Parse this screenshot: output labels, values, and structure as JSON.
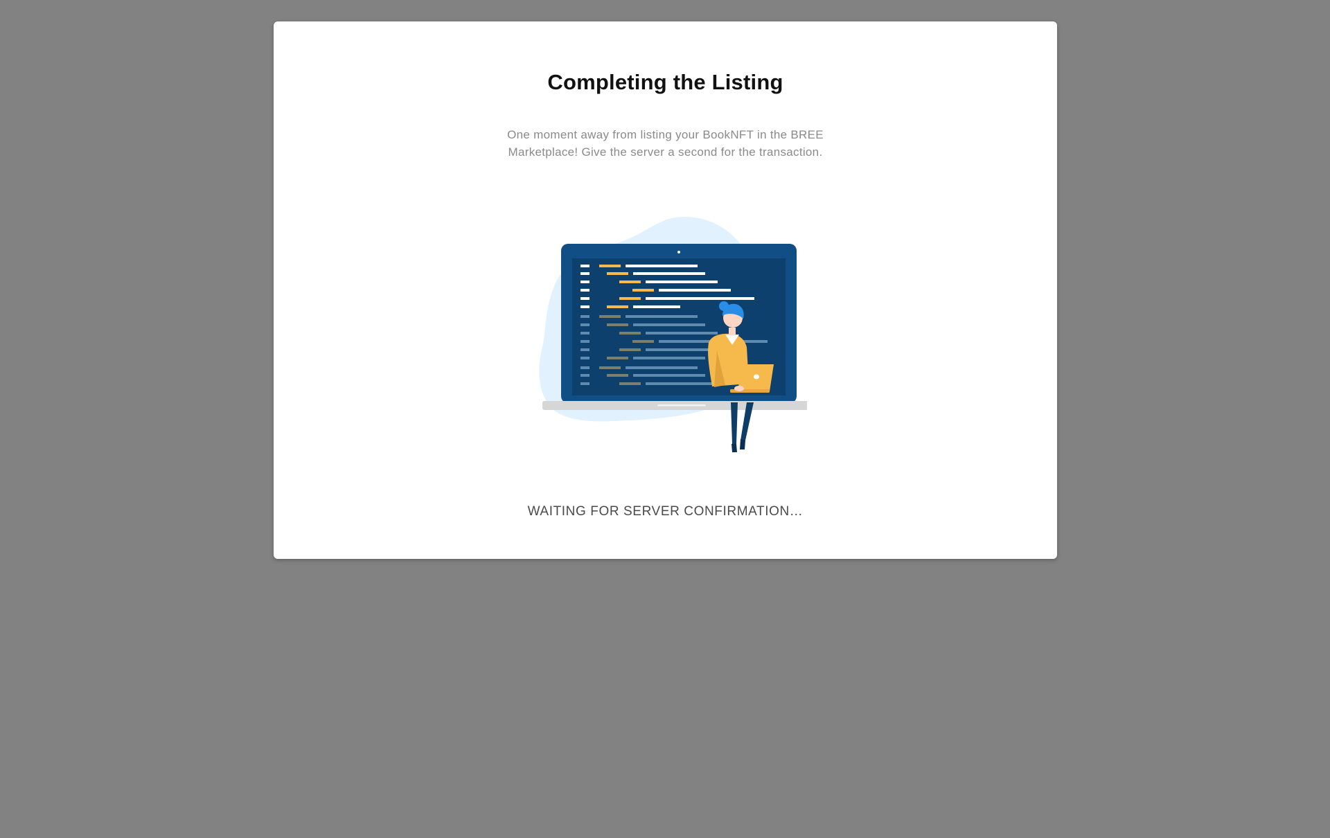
{
  "dialog": {
    "title": "Completing the Listing",
    "description": "One moment away from listing your BookNFT in the BREE Marketplace! Give the server a second for the transaction.",
    "status": "WAITING FOR SERVER CONFIRMATION…"
  },
  "illustration": {
    "icon": "developer-at-laptop-illustration"
  },
  "colors": {
    "overlay": "#828282",
    "blob": "#e1f1fe",
    "screen": "#0e4a7d",
    "accent": "#f6b94b"
  }
}
